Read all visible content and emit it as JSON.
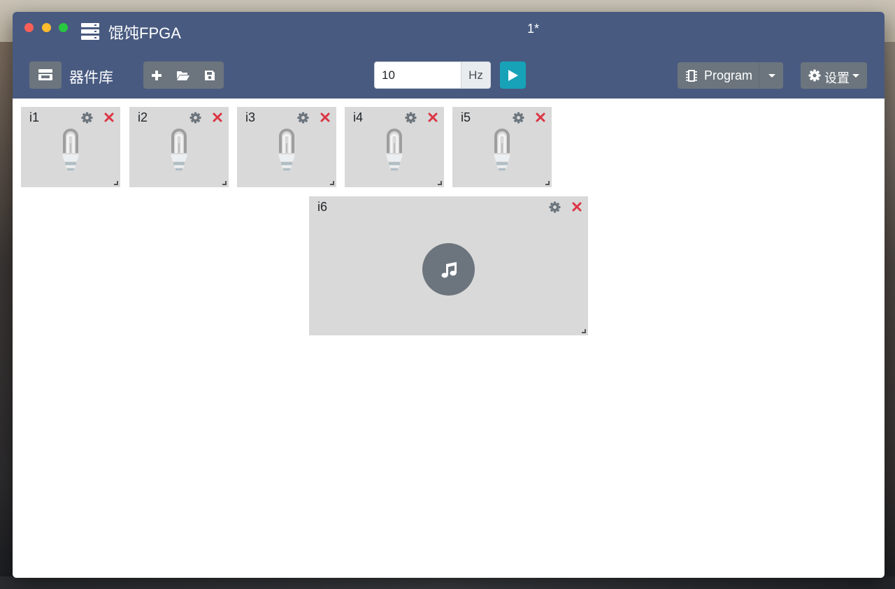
{
  "window": {
    "app_title": "馄饨FPGA",
    "doc_title": "1*"
  },
  "toolbar": {
    "library_label": "器件库",
    "frequency_value": "10",
    "frequency_unit": "Hz",
    "program_label": "Program",
    "settings_label": "设置"
  },
  "icons": {
    "app": "server-icon",
    "library": "store-icon",
    "new": "plus-icon",
    "open": "folder-open-icon",
    "save": "save-icon",
    "run": "play-icon",
    "program": "chip-icon",
    "settings": "gear-icon",
    "card_settings": "gear-icon",
    "card_remove": "close-icon",
    "bulb": "lightbulb-icon",
    "buzzer": "music-note-icon"
  },
  "colors": {
    "titlebar": "#485a80",
    "button_gray": "#6c757d",
    "play": "#17a2b8",
    "remove": "#dc3545",
    "card_bg": "#d9d9d9"
  },
  "components": [
    {
      "id": "i1",
      "type": "bulb"
    },
    {
      "id": "i2",
      "type": "bulb"
    },
    {
      "id": "i3",
      "type": "bulb"
    },
    {
      "id": "i4",
      "type": "bulb"
    },
    {
      "id": "i5",
      "type": "bulb"
    },
    {
      "id": "i6",
      "type": "buzzer"
    }
  ]
}
